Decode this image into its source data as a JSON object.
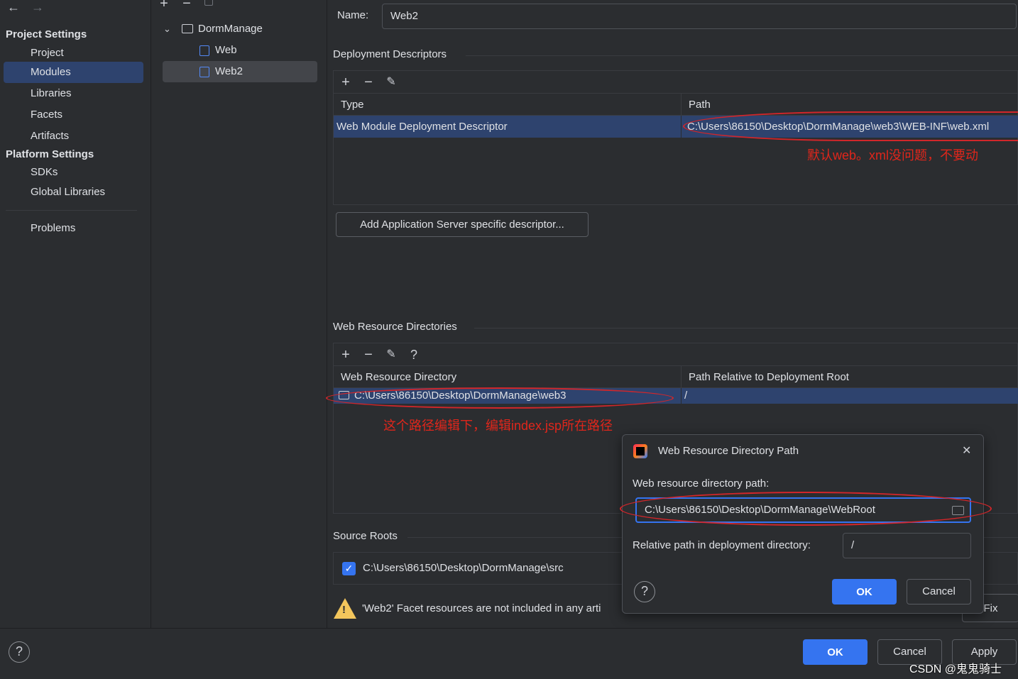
{
  "nav": {
    "back_arrow": "←",
    "forward_arrow": "→",
    "project_settings": "Project Settings",
    "project": "Project",
    "modules": "Modules",
    "libraries": "Libraries",
    "facets": "Facets",
    "artifacts": "Artifacts",
    "platform_settings": "Platform Settings",
    "sdks": "SDKs",
    "global_libraries": "Global Libraries",
    "problems": "Problems"
  },
  "tree": {
    "root": "DormManage",
    "items": [
      "Web",
      "Web2"
    ]
  },
  "main": {
    "name_label": "Name:",
    "name_value": "Web2",
    "deployment_descriptors_title": "Deployment Descriptors",
    "dd_columns": [
      "Type",
      "Path"
    ],
    "dd_row": {
      "type": "Web Module Deployment Descriptor",
      "path": "C:\\Users\\86150\\Desktop\\DormManage\\web3\\WEB-INF\\web.xml"
    },
    "annotation_1": "默认web。xml没问题，不要动",
    "add_server_descriptor_button": "Add Application Server specific descriptor...",
    "web_resource_title": "Web Resource Directories",
    "wr_columns": [
      "Web Resource Directory",
      "Path Relative to Deployment Root"
    ],
    "wr_row": {
      "directory": "C:\\Users\\86150\\Desktop\\DormManage\\web3",
      "relative": "/"
    },
    "annotation_2": "这个路径编辑下，编辑index.jsp所在路径",
    "source_roots_title": "Source Roots",
    "source_root_path": "C:\\Users\\86150\\Desktop\\DormManage\\src",
    "warning_text": "'Web2' Facet resources are not included in any arti",
    "fix_button": "Fix"
  },
  "dialog": {
    "title": "Web Resource Directory Path",
    "path_label": "Web resource directory path:",
    "path_value": "C:\\Users\\86150\\Desktop\\DormManage\\WebRoot",
    "relative_label": "Relative path in deployment directory:",
    "relative_value": "/",
    "ok": "OK",
    "cancel": "Cancel",
    "help": "?",
    "close": "✕"
  },
  "footer": {
    "help": "?",
    "ok": "OK",
    "cancel": "Cancel",
    "apply": "Apply",
    "watermark": "CSDN @鬼鬼骑士"
  },
  "colors": {
    "background": "#2b2d30",
    "selection": "#2e436e",
    "primary_button": "#3574f0",
    "annotation_red": "#e0261b"
  }
}
